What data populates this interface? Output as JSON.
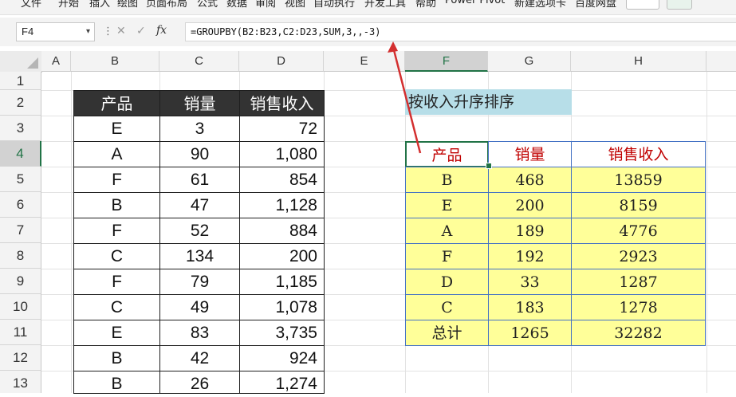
{
  "ribbon": {
    "tabs": [
      "文件",
      "开始",
      "插入",
      "绘图",
      "页面布局",
      "公式",
      "数据",
      "审阅",
      "视图",
      "自动执行",
      "开发工具",
      "帮助",
      "Power Pivot",
      "新建选项卡",
      "百度网盘"
    ]
  },
  "formula_bar": {
    "name_box": "F4",
    "name_dropdown_icon": "chevron-down",
    "more_icon": "⋮",
    "cancel_icon": "✕",
    "enter_icon": "✓",
    "fx_label": "fx",
    "formula": "=GROUPBY(B2:B23,C2:D23,SUM,3,,-3)"
  },
  "columns": [
    "A",
    "B",
    "C",
    "D",
    "E",
    "F",
    "G",
    "H"
  ],
  "active_column": "F",
  "rows": [
    "1",
    "2",
    "3",
    "4",
    "5",
    "6",
    "7",
    "8",
    "9",
    "10",
    "11",
    "12",
    "13"
  ],
  "active_row": "4",
  "source_table": {
    "headers": [
      "产品",
      "销量",
      "销售收入"
    ],
    "rows": [
      [
        "E",
        "3",
        "72"
      ],
      [
        "A",
        "90",
        "1,080"
      ],
      [
        "F",
        "61",
        "854"
      ],
      [
        "B",
        "47",
        "1,128"
      ],
      [
        "F",
        "52",
        "884"
      ],
      [
        "C",
        "134",
        "200"
      ],
      [
        "F",
        "79",
        "1,185"
      ],
      [
        "C",
        "49",
        "1,078"
      ],
      [
        "E",
        "83",
        "3,735"
      ],
      [
        "B",
        "42",
        "924"
      ],
      [
        "B",
        "26",
        "1,274"
      ]
    ]
  },
  "note": "按收入升序排序",
  "result_table": {
    "headers": [
      "产品",
      "销量",
      "销售收入"
    ],
    "rows": [
      [
        "B",
        "468",
        "13859"
      ],
      [
        "E",
        "200",
        "8159"
      ],
      [
        "A",
        "189",
        "4776"
      ],
      [
        "F",
        "192",
        "2923"
      ],
      [
        "D",
        "33",
        "1287"
      ],
      [
        "C",
        "183",
        "1278"
      ],
      [
        "总计",
        "1265",
        "32282"
      ]
    ]
  },
  "colors": {
    "source_header_bg": "#333333",
    "result_header_text": "#c00000",
    "result_body_bg": "#ffff99",
    "note_bg": "#b7dee8",
    "table_border": "#4472c4",
    "selection": "#217346",
    "arrow": "#d32f2f"
  }
}
